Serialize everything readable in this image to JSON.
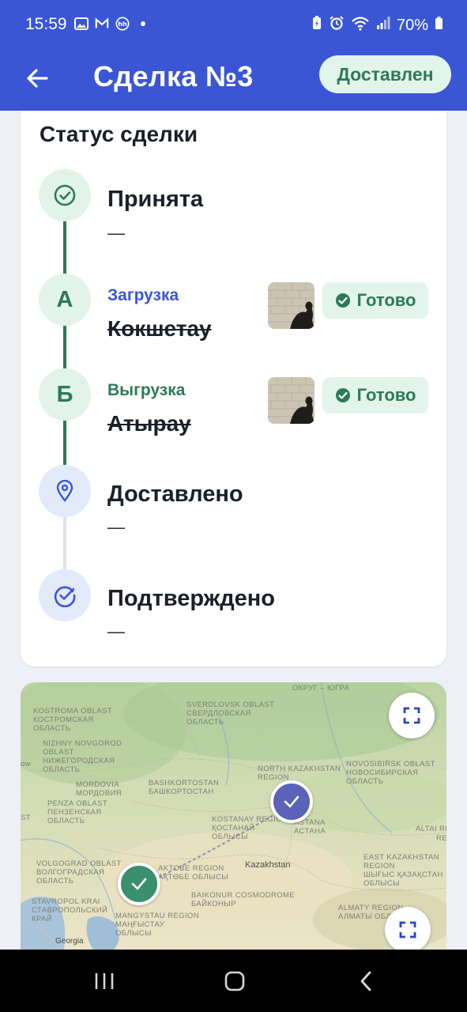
{
  "status_bar": {
    "time": "15:59",
    "battery": "70%"
  },
  "header": {
    "title": "Сделка №3",
    "status_chip": "Доставлен"
  },
  "deal_status": {
    "title": "Статус сделки",
    "steps": [
      {
        "name": "Принята",
        "value": "—"
      },
      {
        "letter": "А",
        "label": "Загрузка",
        "city": "Кокшетау",
        "badge": "Готово"
      },
      {
        "letter": "Б",
        "label": "Выгрузка",
        "city": "Атырау",
        "badge": "Готово"
      },
      {
        "name": "Доставлено",
        "value": "—"
      },
      {
        "name": "Подтверждено",
        "value": "—"
      }
    ]
  },
  "map": {
    "labels": {
      "okrug": "ОКРУГ – ЮГРА",
      "sverdlovsk": "SVERDLOVSK OBLAST\nСВЕРДЛОВСКАЯ\nОБЛАСТЬ",
      "kostroma": "KOSTROMA OBLAST\nКОСТРОМСКАЯ\nОБЛАСТЬ",
      "nizhny": "NIZHNY NOVGOROD\nOBLAST\nНИЖЕГОРОДСКАЯ\nОБЛАСТЬ",
      "mordovia": "MORDOVIA\nМОРДОВИЯ",
      "penza": "PENZA OBLAST\nПЕНЗЕНСКАЯ\nОБЛАСТЬ",
      "bashkortostan": "BASHKORTOSTAN\nБАШКОРТОСТАН",
      "north_kz": "NORTH KAZAKHSTAN\nREGION",
      "novosibirsk": "NOVOSIBIRSK OBLAST\nНОВОСИБИРСКАЯ\nОБЛАСТЬ",
      "kostanay": "KOSTANAY REGION\nҚОСТАНАЙ\nОБЛЫСЫ",
      "astana": "ASTANA\nАСТАНА",
      "altai": "ALTAI RE",
      "volgograd": "VOLGOGRAD OBLAST\nВОЛГОГРАДСКАЯ\nОБЛАСТЬ",
      "aktobe": "AKTOBE REGION\nАҚТӨБЕ ОБЛЫСЫ",
      "kazakhstan": "Kazakhstan",
      "east_kz": "EAST KAZAKHSTAN\nREGION\nШЫҒЫС ҚАЗАҚСТАН\nОБЛЫСЫ",
      "stavropol": "STAVROPOL KRAI\nСТАВРОПОЛЬСКИЙ\nКРАЙ",
      "baikonur": "BAIKONUR COSMODROME\nБАЙКОНЫР",
      "mangystau": "MANGYSTAU REGION\nМАҢҒЫСТАУ\nОБЛЫСЫ",
      "almaty": "ALMATY REGION\nАЛМАТЫ ОБЛЫСЫ",
      "georgia": "Georgia",
      "ow": "ow",
      "st": "ST",
      "re": "RE"
    }
  }
}
